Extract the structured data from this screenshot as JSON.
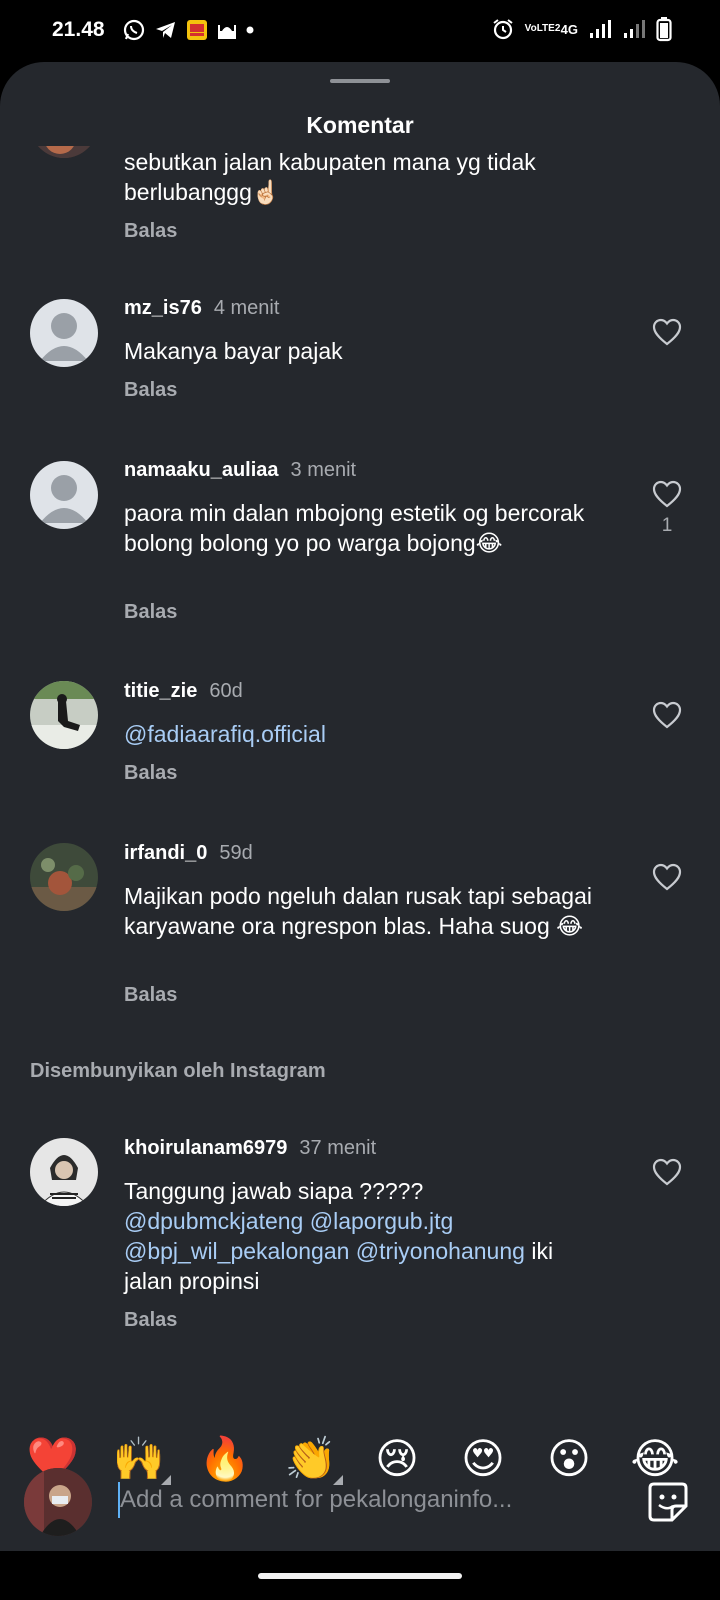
{
  "status_bar": {
    "time": "21.48",
    "network": "4G",
    "volte": "VoLTE2"
  },
  "sheet": {
    "title": "Komentar"
  },
  "comments": [
    {
      "username": "",
      "time": "",
      "text": "sebutkan jalan kabupaten mana yg tidak berlubanggg☝🏻",
      "reply": "Balas"
    },
    {
      "username": "mz_is76",
      "time": "4 menit",
      "text": "Makanya bayar pajak",
      "reply": "Balas"
    },
    {
      "username": "namaaku_auliaa",
      "time": "3 menit",
      "text": "paora min dalan mbojong estetik og bercorak bolong bolong yo po warga bojong😂",
      "likes": "1",
      "reply": "Balas"
    },
    {
      "username": "titie_zie",
      "time": "60d",
      "mention": "@fadiaarafiq.official",
      "reply": "Balas"
    },
    {
      "username": "irfandi_0",
      "time": "59d",
      "text": "Majikan podo ngeluh dalan rusak tapi sebagai karyawane ora ngrespon blas. Haha suog 😂",
      "reply": "Balas"
    },
    {
      "username": "khoirulanam6979",
      "time": "37 menit",
      "text_start": "Tanggung jawab siapa ?????",
      "mentions": [
        "@dpubmckjateng",
        "@laporgub.jtg",
        "@bpj_wil_pekalongan",
        "@triyonohanung"
      ],
      "text_end": "iki jalan propinsi",
      "reply": "Balas"
    }
  ],
  "hidden_label": "Disembunyikan oleh Instagram",
  "reactions": [
    "❤️",
    "🙌",
    "🔥",
    "👏",
    "😢",
    "😍",
    "😮",
    "😂"
  ],
  "compose": {
    "placeholder": "Add a comment for pekalonganinfo..."
  },
  "icons": {
    "heart": "heart-outline-icon",
    "sticker": "sticker-icon"
  },
  "colors": {
    "background": "#25282d",
    "mention": "#a9cdf5",
    "muted": "#a8abb0"
  }
}
